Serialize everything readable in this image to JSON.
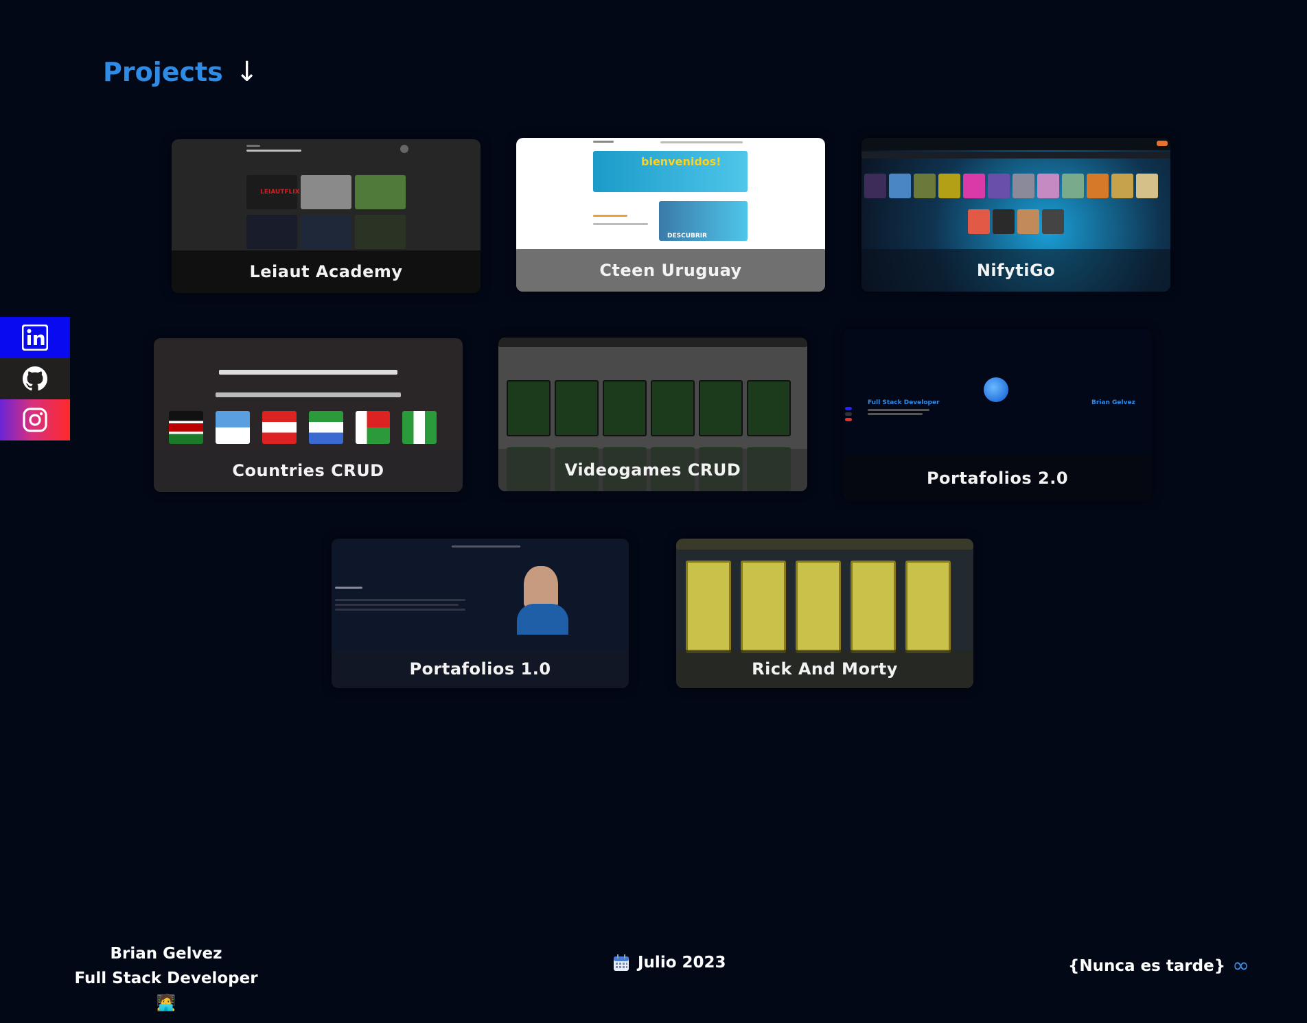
{
  "section": {
    "title": "Projects",
    "arrow": "↓"
  },
  "social": [
    {
      "name": "linkedin-icon",
      "color": "#0a0af0"
    },
    {
      "name": "github-icon",
      "color": "#221f1f"
    },
    {
      "name": "instagram-icon",
      "color": "#d63080"
    }
  ],
  "projects": [
    {
      "label": "Leiaut Academy"
    },
    {
      "label": "Cteen Uruguay"
    },
    {
      "label": "NifytiGo"
    },
    {
      "label": "Countries CRUD"
    },
    {
      "label": "Videogames CRUD"
    },
    {
      "label": "Portafolios 2.0"
    },
    {
      "label": "Portafolios 1.0"
    },
    {
      "label": "Rick And Morty"
    }
  ],
  "footer": {
    "name": "Brian Gelvez",
    "role": "Full Stack Developer 🧑‍💻",
    "date": "Julio 2023",
    "date_icon": "calendar-icon",
    "motto": "{Nunca es tarde}",
    "motto_icon": "∞"
  },
  "colors": {
    "background": "#030817",
    "accent": "#2f8ce6"
  }
}
